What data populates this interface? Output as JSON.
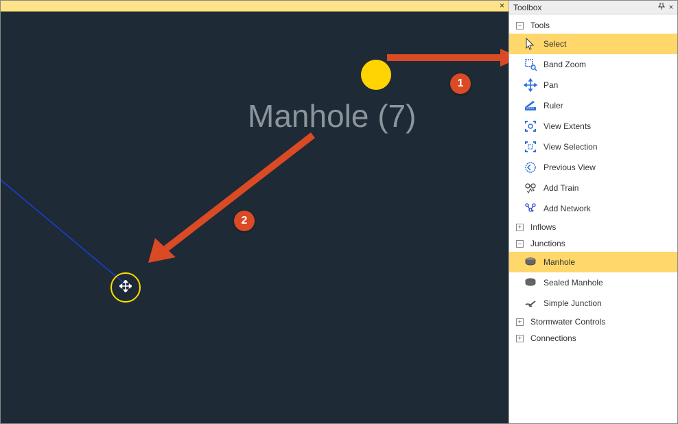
{
  "canvas": {
    "label_text": "Manhole (7)",
    "callouts": {
      "one": "1",
      "two": "2"
    }
  },
  "toolbox": {
    "title": "Toolbox",
    "close": "×",
    "groups": {
      "tools": {
        "label": "Tools",
        "items": {
          "select": "Select",
          "band_zoom": "Band Zoom",
          "pan": "Pan",
          "ruler": "Ruler",
          "view_extents": "View Extents",
          "view_selection": "View Selection",
          "previous_view": "Previous View",
          "add_train": "Add Train",
          "add_network": "Add Network"
        }
      },
      "inflows": {
        "label": "Inflows"
      },
      "junctions": {
        "label": "Junctions",
        "items": {
          "manhole": "Manhole",
          "sealed_manhole": "Sealed Manhole",
          "simple_junction": "Simple Junction"
        }
      },
      "stormwater": {
        "label": "Stormwater Controls"
      },
      "connections": {
        "label": "Connections"
      }
    }
  }
}
